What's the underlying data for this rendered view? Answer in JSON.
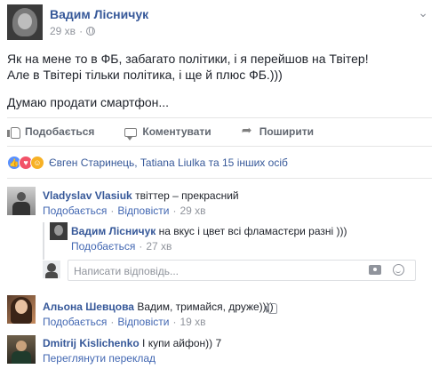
{
  "post": {
    "author": "Вадим Лісничук",
    "time": "29 хв",
    "privacy_icon": "globe-icon",
    "chevron": "⌄",
    "lines": [
      "Як на мене то в ФБ, забагато політики, і я перейшов на Твітер!",
      "Але в Твітері тільки політика, і ще й плюс ФБ.)))"
    ],
    "line_after": "Думаю продати смартфон..."
  },
  "actions": {
    "like": "Подобається",
    "comment": "Коментувати",
    "share": "Поширити"
  },
  "reactions": {
    "icons": [
      "like-reaction-icon",
      "love-reaction-icon",
      "haha-reaction-icon"
    ],
    "colors": {
      "like": "#5890ff",
      "love": "#f25268",
      "haha": "#f7b125"
    },
    "summary": "Євген Старинець, Tatiana Liulka та 15 інших осіб"
  },
  "comments": [
    {
      "author": "Vladyslav Vlasiuk",
      "text": "твіттер – прекрасний",
      "like": "Подобається",
      "reply": "Відповісти",
      "time": "29 хв"
    },
    {
      "author": "Альона Шевцова",
      "text": "Вадим, тримайся, друже))))",
      "like": "Подобається",
      "reply": "Відповісти",
      "time": "19 хв"
    },
    {
      "author": "Dmitrij Kislichenko",
      "text": "І купи айфон)) 7",
      "translate": "Переглянути переклад"
    }
  ],
  "reply": {
    "author": "Вадим Лісничук",
    "text": "на вкус і цвет всі фламастєри разні )))",
    "like": "Подобається",
    "time": "27 хв"
  },
  "reply_input": {
    "placeholder": "Написати відповідь..."
  },
  "colors": {
    "link": "#365899",
    "meta": "#90949c",
    "text": "#1d2129"
  }
}
